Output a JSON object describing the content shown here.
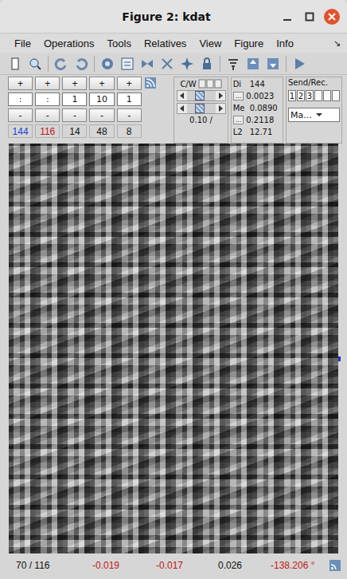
{
  "window": {
    "title": "Figure 2: kdat"
  },
  "menu": {
    "items": [
      "File",
      "Operations",
      "Tools",
      "Relatives",
      "View",
      "Figure",
      "Info"
    ],
    "arrow": "↘"
  },
  "dims": [
    {
      "plus": "+",
      "value": ":",
      "minus": "-",
      "size": "144",
      "color": "#1f3fd0"
    },
    {
      "plus": "+",
      "value": ":",
      "minus": "-",
      "size": "116",
      "color": "#c01818"
    },
    {
      "plus": "+",
      "value": "1",
      "minus": "-",
      "size": "14",
      "color": "#111111"
    },
    {
      "plus": "+",
      "value": "10",
      "minus": "-",
      "size": "48",
      "color": "#111111"
    },
    {
      "plus": "+",
      "value": "1",
      "minus": "-",
      "size": "8",
      "color": "#111111"
    }
  ],
  "cw": {
    "label": "C/W",
    "sliders": [
      {
        "level": 0.45
      },
      {
        "level": 0.45
      }
    ],
    "value": "0.10 /"
  },
  "stats": [
    {
      "label": "Di",
      "value": "144"
    },
    {
      "button": "...",
      "value": "0.0023"
    },
    {
      "label": "Me",
      "value": "0.0890"
    },
    {
      "button": "...",
      "value": "0.2118"
    },
    {
      "label": "L2",
      "value": "12.71"
    }
  ],
  "send": {
    "label": "Send/Rec.",
    "buttons": [
      "1",
      "2",
      "3",
      "",
      "",
      ""
    ],
    "dropdown": "Ma..."
  },
  "status_bar": [
    {
      "text": "70  /  116",
      "color": "#111111"
    },
    {
      "text": "-0.019",
      "color": "#c01818"
    },
    {
      "text": "-0.017",
      "color": "#c01818"
    },
    {
      "text": "0.026",
      "color": "#111111"
    },
    {
      "text": "-138.206 °",
      "color": "#c01818"
    }
  ]
}
